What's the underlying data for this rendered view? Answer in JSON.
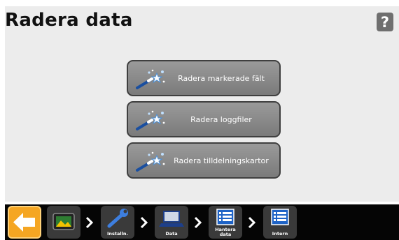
{
  "header": {
    "title": "Radera data",
    "help_symbol": "?"
  },
  "actions": [
    {
      "label": "Radera markerade fält",
      "icon": "wand-icon"
    },
    {
      "label": "Radera loggfiler",
      "icon": "wand-icon"
    },
    {
      "label": "Radera tilldelningskartor",
      "icon": "wand-icon"
    }
  ],
  "breadcrumb": {
    "back_icon": "back-arrow-icon",
    "items": [
      {
        "label": "",
        "icon": "display-icon"
      },
      {
        "label": "Installn.",
        "icon": "wrench-icon"
      },
      {
        "label": "Data",
        "icon": "laptop-icon"
      },
      {
        "label": "Hantera data",
        "icon": "list-icon"
      },
      {
        "label": "Intern",
        "icon": "list-icon"
      }
    ]
  },
  "colors": {
    "back_button": "#f5a623",
    "action_button": "#8a8a8a",
    "bar": "#050505"
  }
}
